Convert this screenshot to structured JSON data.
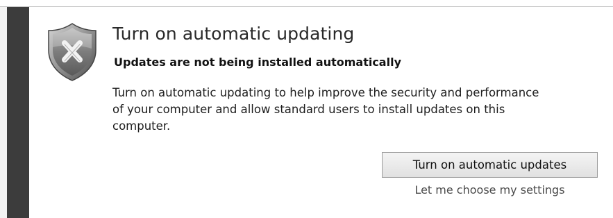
{
  "notification": {
    "title": "Turn on automatic updating",
    "subtitle": "Updates are not being installed automatically",
    "description": "Turn on automatic updating to help improve the security and performance of your computer and allow standard users to install updates on this computer.",
    "status_icon": "shield-error-icon",
    "status_icon_glyph": "✖"
  },
  "actions": {
    "primary_label": "Turn on automatic updates",
    "secondary_label": "Let me choose my settings"
  },
  "colors": {
    "status_bar": "#3c3c3c",
    "shield_fill": "#8a8a8a",
    "background": "#ffffff"
  }
}
